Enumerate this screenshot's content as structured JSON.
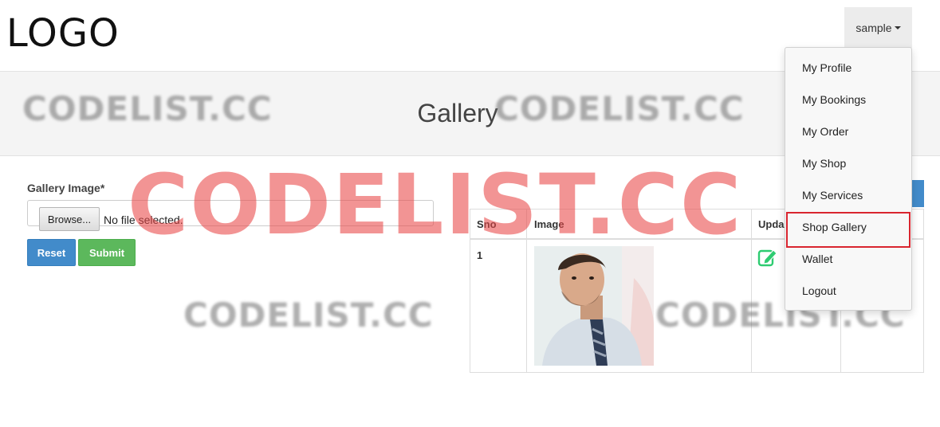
{
  "navbar": {
    "logo": "LOGO",
    "user": "sample"
  },
  "banner": {
    "title": "Gallery"
  },
  "form": {
    "label": "Gallery Image*",
    "browse_label": "Browse...",
    "file_status": "No file selected.",
    "reset_label": "Reset",
    "submit_label": "Submit"
  },
  "table": {
    "headers": [
      "Sno",
      "Image",
      "Upda"
    ],
    "rows": [
      {
        "sno": "1"
      }
    ]
  },
  "dropdown": {
    "items": [
      "My Profile",
      "My Bookings",
      "My Order",
      "My Shop",
      "My Services",
      "Shop Gallery",
      "Wallet",
      "Logout"
    ],
    "highlighted": "Shop Gallery"
  },
  "watermark": {
    "text": "CODELIST.CC"
  },
  "colors": {
    "primary": "#428bca",
    "success": "#5cb85c",
    "highlight": "#d9252f",
    "edit_icon": "#2ecc71"
  }
}
